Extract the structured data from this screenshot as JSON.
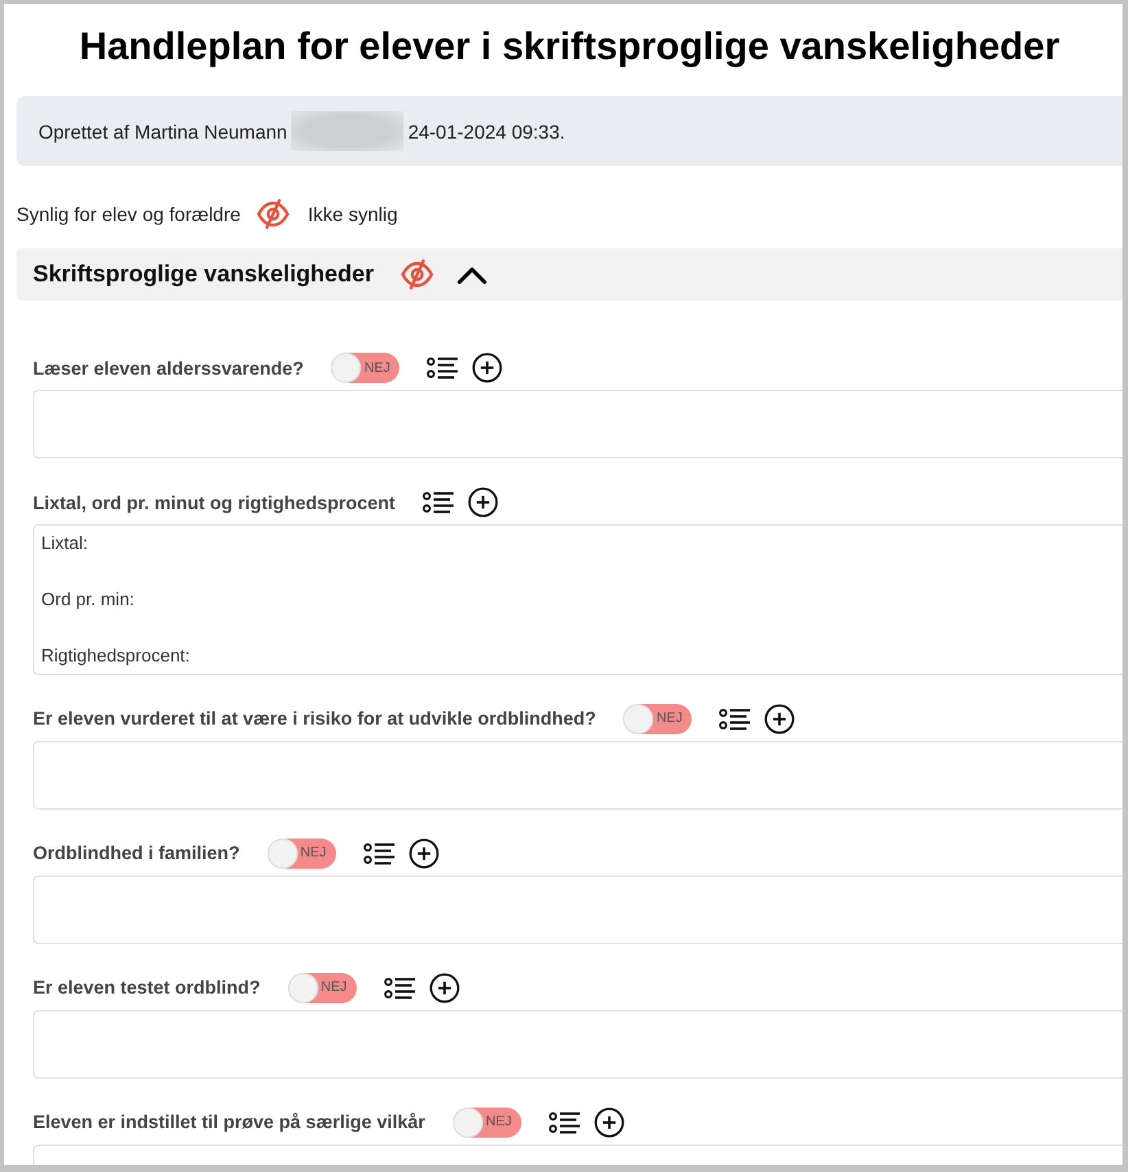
{
  "title": "Handleplan for elever i skriftsproglige vanskeligheder",
  "created_info": {
    "text": "Oprettet af Martina Neumann",
    "redacted": true,
    "timestamp": "24-01-2024 09:33."
  },
  "visibility_legend": {
    "visible_label": "Synlig for elev og forældre",
    "hidden_label": "Ikke synlig"
  },
  "section": {
    "title": "Skriftsproglige vanskeligheder",
    "visible": false,
    "expanded": true,
    "questions": [
      {
        "label": "Læser eleven alderssvarende?",
        "toggle": {
          "on": false,
          "label": "NEJ"
        }
      },
      {
        "label": "Lixtal, ord pr. minut og rigtighedsprocent",
        "value": "Lixtal:\n\nOrd pr. min:\n\nRigtighedsprocent:"
      },
      {
        "label": "Er eleven vurderet til at være i risiko for at udvikle ordblindhed?",
        "toggle": {
          "on": false,
          "label": "NEJ"
        }
      },
      {
        "label": "Ordblindhed i familien?",
        "toggle": {
          "on": false,
          "label": "NEJ"
        }
      },
      {
        "label": "Er eleven testet ordblind?",
        "toggle": {
          "on": false,
          "label": "NEJ"
        }
      },
      {
        "label": "Eleven er indstillet til prøve på særlige vilkår",
        "toggle": {
          "on": false,
          "label": "NEJ"
        }
      }
    ]
  }
}
